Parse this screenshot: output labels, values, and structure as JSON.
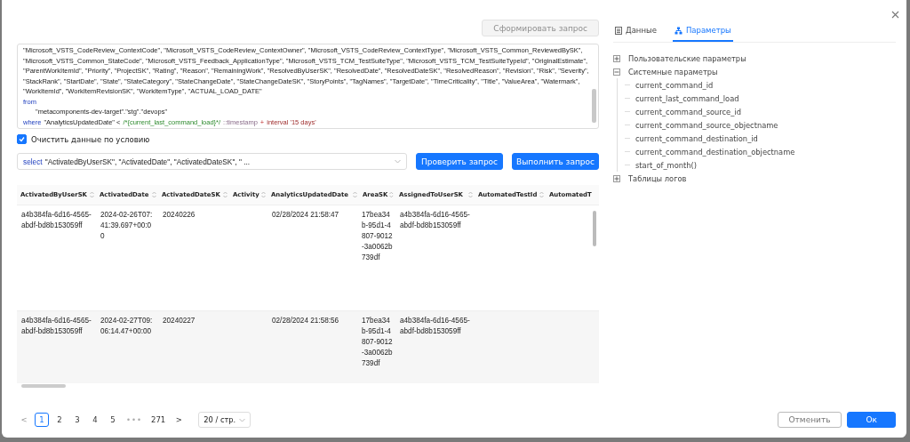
{
  "generate_button": {
    "label": "Сформировать запрос",
    "disabled": true
  },
  "editor": {
    "lines": [
      {
        "indent": false,
        "tokens": [
          {
            "kind": "plain",
            "text": "\"Microsoft_VSTS_CodeReview_ContextCode\", \"Microsoft_VSTS_CodeReview_ContextOwner\", \"Microsoft_VSTS_CodeReview_ContextType\", \"Microsoft_VSTS_Common_ReviewedBySK\","
          }
        ]
      },
      {
        "indent": false,
        "tokens": [
          {
            "kind": "plain",
            "text": "\"Microsoft_VSTS_Common_StateCode\", \"Microsoft_VSTS_Feedback_ApplicationType\", \"Microsoft_VSTS_TCM_TestSuiteType\", \"Microsoft_VSTS_TCM_TestSuiteTypeId\", \"OriginalEstimate\","
          }
        ]
      },
      {
        "indent": false,
        "tokens": [
          {
            "kind": "plain",
            "text": "\"ParentWorkItemId\", \"Priority\", \"ProjectSK\", \"Rating\", \"Reason\", \"RemainingWork\", \"ResolvedByUserSK\", \"ResolvedDate\", \"ResolvedDateSK\", \"ResolvedReason\", \"Revision\", \"Risk\", \"Severity\","
          }
        ]
      },
      {
        "indent": false,
        "tokens": [
          {
            "kind": "plain",
            "text": "\"StackRank\", \"StartDate\", \"State\", \"StateCategory\", \"StateChangeDate\", \"StateChangeDateSK\", \"StoryPoints\", \"TagNames\", \"TargetDate\", \"TimeCriticality\", \"Title\", \"ValueArea\", \"Watermark\","
          }
        ]
      },
      {
        "indent": false,
        "tokens": [
          {
            "kind": "plain",
            "text": "\"WorkItemId\", \"WorkItemRevisionSK\", \"WorkItemType\", \"ACTUAL_LOAD_DATE\""
          }
        ]
      },
      {
        "indent": false,
        "tokens": [
          {
            "kind": "keyword",
            "text": "from"
          }
        ]
      },
      {
        "indent": true,
        "tokens": [
          {
            "kind": "plain",
            "text": "\"metacomponents-dev-target\".\"stg\".\"devops\""
          }
        ]
      },
      {
        "indent": false,
        "tokens": [
          {
            "kind": "keyword",
            "text": "where"
          },
          {
            "kind": "plain",
            "text": "\"AnalyticsUpdatedDate\" <"
          },
          {
            "kind": "comment",
            "text": "/*{current_last_command_load}*/"
          },
          {
            "kind": "cast",
            "text": "::timestamp"
          },
          {
            "kind": "operator",
            "text": "+"
          },
          {
            "kind": "string",
            "text": "interval '15 days'"
          }
        ]
      }
    ]
  },
  "clear_option": {
    "label": "Очистить данные по условию",
    "checked": true
  },
  "query_select": {
    "tokens": [
      {
        "kind": "keyword",
        "text": "select"
      },
      {
        "kind": "plain",
        "text": "\"ActivatedByUserSK\", \"ActivatedDate\", \"ActivatedDateSK\", \" ..."
      }
    ]
  },
  "check_button": {
    "label": "Проверить запрос"
  },
  "run_button": {
    "label": "Выполнить запрос"
  },
  "table": {
    "columns": [
      {
        "label": "ActivatedByUserSK",
        "sortable": true
      },
      {
        "label": "ActivatedDate",
        "sortable": true
      },
      {
        "label": "ActivatedDateSK",
        "sortable": true
      },
      {
        "label": "Activity",
        "sortable": true
      },
      {
        "label": "AnalyticsUpdatedDate",
        "sortable": true
      },
      {
        "label": "AreaSK",
        "sortable": true
      },
      {
        "label": "AssignedToUserSK",
        "sortable": true
      },
      {
        "label": "AutomatedTestId",
        "sortable": true
      },
      {
        "label": "AutomatedT",
        "sortable": false
      }
    ],
    "rows": [
      {
        "cells": [
          "a4b384fa-6d16-4565-abdf-bd8b153059ff",
          "2024-02-26T07:41:39.697+00:00",
          "20240226",
          null,
          "02/28/2024 21:58:47",
          "17bea34b-95d1-4807-9012-3a0062b739df",
          "a4b384fa-6d16-4565-abdf-bd8b153059ff"
        ]
      },
      {
        "cells": [
          "a4b384fa-6d16-4565-abdf-bd8b153059ff",
          "2024-02-27T09:06:14.47+00:00",
          "20240227",
          null,
          "02/28/2024 21:58:56",
          "17bea34b-95d1-4807-9012-3a0062b739df",
          "a4b384fa-6d16-4565-abdf-bd8b153059ff"
        ]
      }
    ]
  },
  "pagination": {
    "prev": {
      "label": "<",
      "disabled": true
    },
    "pages": [
      {
        "label": "1",
        "selected": true
      },
      {
        "label": "2",
        "selected": false
      },
      {
        "label": "3",
        "selected": false
      },
      {
        "label": "4",
        "selected": false
      },
      {
        "label": "5",
        "selected": false
      }
    ],
    "ellipsis": "•••",
    "last": {
      "label": "271",
      "selected": false
    },
    "next": {
      "label": ">",
      "disabled": false
    },
    "page_size": "20 / стр."
  },
  "tabs": [
    {
      "label": "Данные",
      "kind": "list",
      "selected": false
    },
    {
      "label": "Параметры",
      "kind": "hierarchy",
      "selected": true
    }
  ],
  "tree": [
    {
      "label": "Пользовательские параметры",
      "expanded": false
    },
    {
      "label": "Системные параметры",
      "expanded": true,
      "children": [
        {
          "label": "current_command_id"
        },
        {
          "label": "current_last_command_load"
        },
        {
          "label": "current_command_source_id"
        },
        {
          "label": "current_command_source_objectname"
        },
        {
          "label": "current_command_destination_id"
        },
        {
          "label": "current_command_destination_objectname"
        },
        {
          "label": "start_of_month()"
        }
      ]
    },
    {
      "label": "Таблицы логов",
      "expanded": false
    }
  ],
  "cancel_button": {
    "label": "Отменить"
  },
  "ok_button": {
    "label": "Ок"
  }
}
